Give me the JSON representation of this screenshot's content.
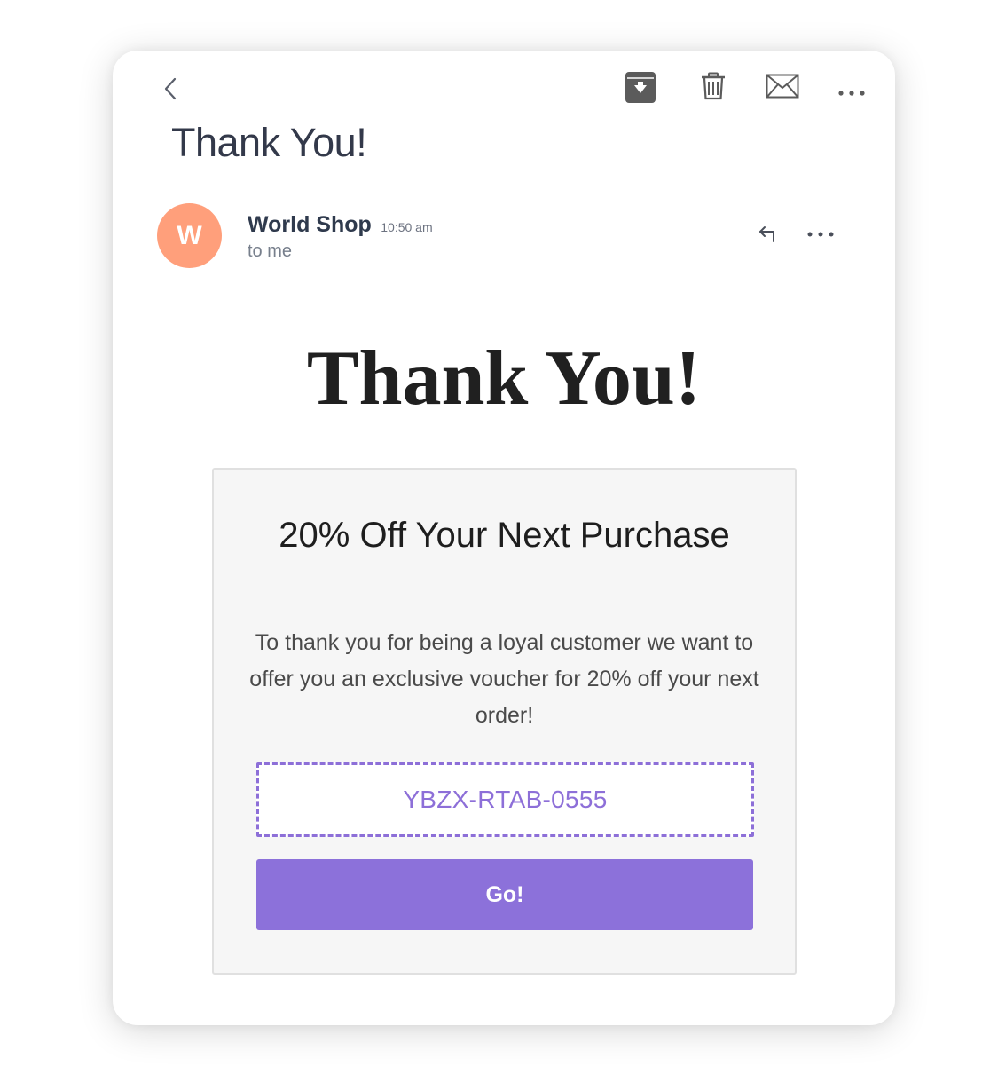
{
  "toolbar": {
    "back_icon": "chevron-left-icon",
    "archive_icon": "archive-icon",
    "delete_icon": "trash-icon",
    "mark_unread_icon": "envelope-icon",
    "more_icon": "more-horizontal-icon"
  },
  "email": {
    "subject": "Thank You!",
    "avatar_letter": "W",
    "avatar_color": "#ff9f7b",
    "sender_name": "World Shop",
    "time": "10:50 am",
    "recipient": "to me",
    "reply_icon": "reply-icon",
    "more_icon": "more-horizontal-icon"
  },
  "body": {
    "heading": "Thank You!",
    "promo": {
      "title": "20% Off Your Next Purchase",
      "text": "To thank you for being a loyal customer we want to offer you an exclusive voucher for 20% off your next order!",
      "voucher_code": "YBZX-RTAB-0555",
      "button_label": "Go!",
      "accent_color": "#8c71da"
    }
  }
}
